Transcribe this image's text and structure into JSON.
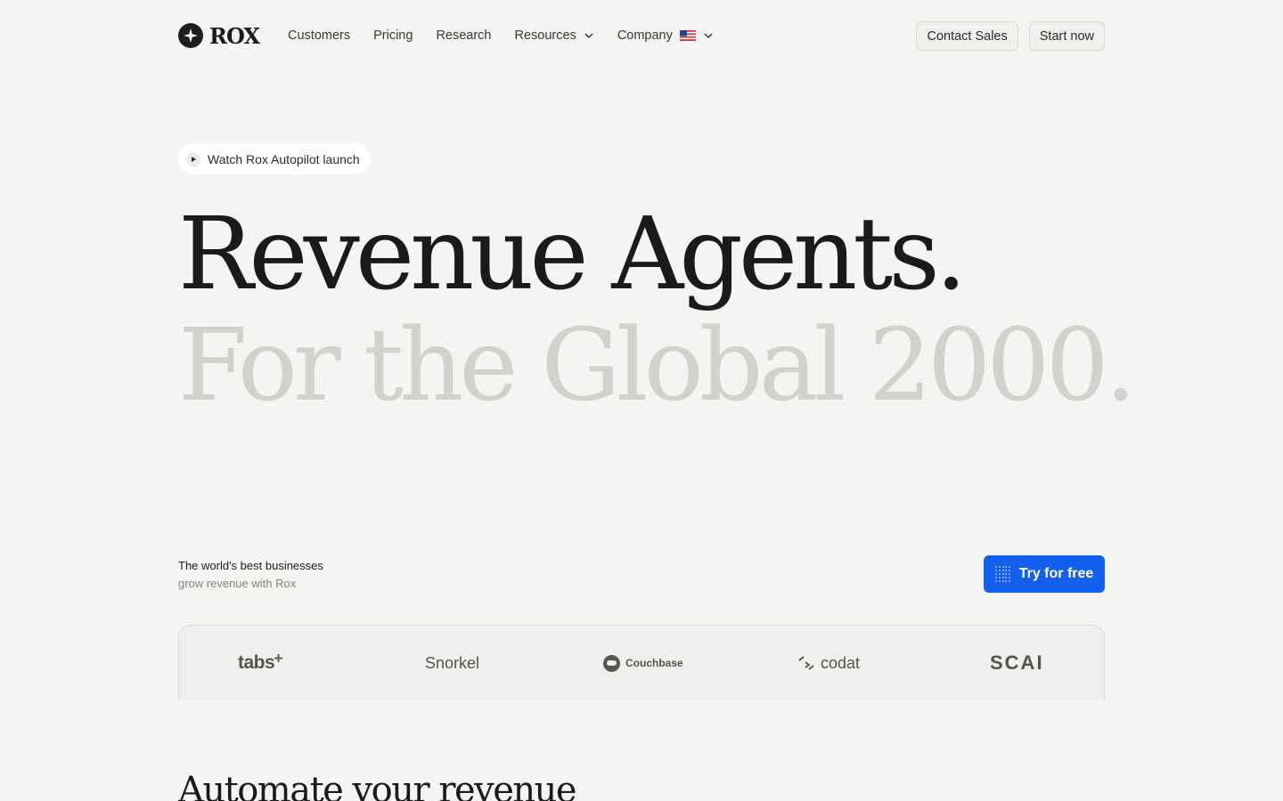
{
  "brand": {
    "name": "ROX"
  },
  "nav": {
    "links": [
      {
        "label": "Customers"
      },
      {
        "label": "Pricing"
      },
      {
        "label": "Research"
      },
      {
        "label": "Resources"
      },
      {
        "label": "Company"
      }
    ],
    "contact_label": "Contact Sales",
    "start_label": "Start now"
  },
  "hero": {
    "pill_label": "Watch Rox Autopilot launch",
    "headline": "Revenue Agents.",
    "subheadline": "For the Global 2000."
  },
  "customers": {
    "tagline_1": "The world's best businesses",
    "tagline_2": "grow revenue with Rox",
    "cta_label": "Try for free",
    "logos": [
      "tabs",
      "Snorkel",
      "Couchbase",
      "codat",
      "SCAI"
    ]
  },
  "section": {
    "heading": "Automate your revenue"
  },
  "colors": {
    "accent": "#1460ee",
    "muted_heading": "#d3d1ce",
    "background": "#f4f4f2"
  }
}
